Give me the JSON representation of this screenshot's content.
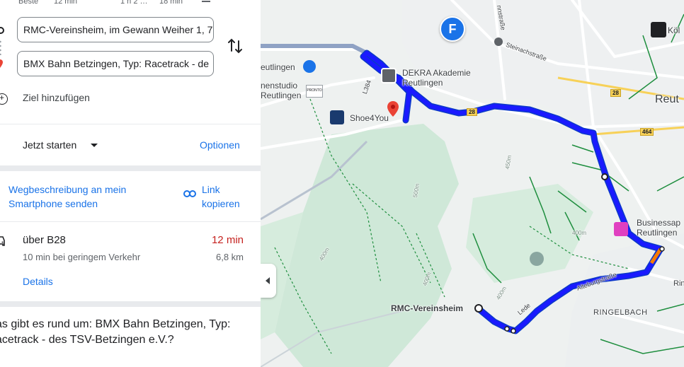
{
  "travel_modes": [
    {
      "label": "Beste",
      "icon": "best-route-icon"
    },
    {
      "label": "12 min",
      "icon": "car-icon"
    },
    {
      "label": "1 h 2 …",
      "icon": "transit-icon"
    },
    {
      "label": "18 min",
      "icon": "bike-icon"
    }
  ],
  "origin": {
    "value": "RMC-Vereinsheim, im Gewann Weiher 1, 7"
  },
  "destination": {
    "value": "BMX Bahn Betzingen, Typ: Racetrack - de"
  },
  "add_destination": "Ziel hinzufügen",
  "depart": {
    "label": "Jetzt starten"
  },
  "options": "Optionen",
  "send_to_phone": "Wegbeschreibung an mein Smartphone senden",
  "copy_link": "Link kopieren",
  "route": {
    "via": "über B28",
    "duration": "12 min",
    "traffic_note": "10 min bei geringem Verkehr",
    "distance": "6,8 km",
    "details_link": "Details"
  },
  "about": "as gibt es rund um: BMX Bahn Betzingen, Typ: acetrack - des TSV-Betzingen e.V.?",
  "map": {
    "marker_letter": "F",
    "labels": {
      "dekra": "DEKRA Akademie Reutlingen",
      "studio": "nenstudio Reutlingen",
      "shoe4you": "Shoe4You",
      "reutlingen_partial": "eutlingen",
      "reut": "Reut",
      "businessapt": "Businessap Reutlingen",
      "rmc": "RMC-Vereinsheim",
      "ringelbach": "RINGELBACH",
      "ring": "Ring",
      "koln": "Köl",
      "steinachstrasse": "Steinachstraße",
      "nnstrasse": "nnstraße",
      "alteburgstrasse": "Alteburgstraße",
      "lederstr": "Lede",
      "l1384": "L384",
      "b28a": "28",
      "b28b": "28",
      "b464": "464",
      "e400a": "400m",
      "e400b": "400m",
      "e400c": "400m",
      "e400d": "400m",
      "e450": "450m",
      "e500": "500m",
      "pronto": "PRONTO"
    },
    "colors": {
      "route": "#1a1aff",
      "route_outline": "#0b39c7",
      "forest": "#c9e6d3",
      "road": "#ffffff",
      "green_path": "#1e8e3e",
      "brand_blue": "#1a73e8",
      "hotel_pink": "#e040c0"
    }
  }
}
